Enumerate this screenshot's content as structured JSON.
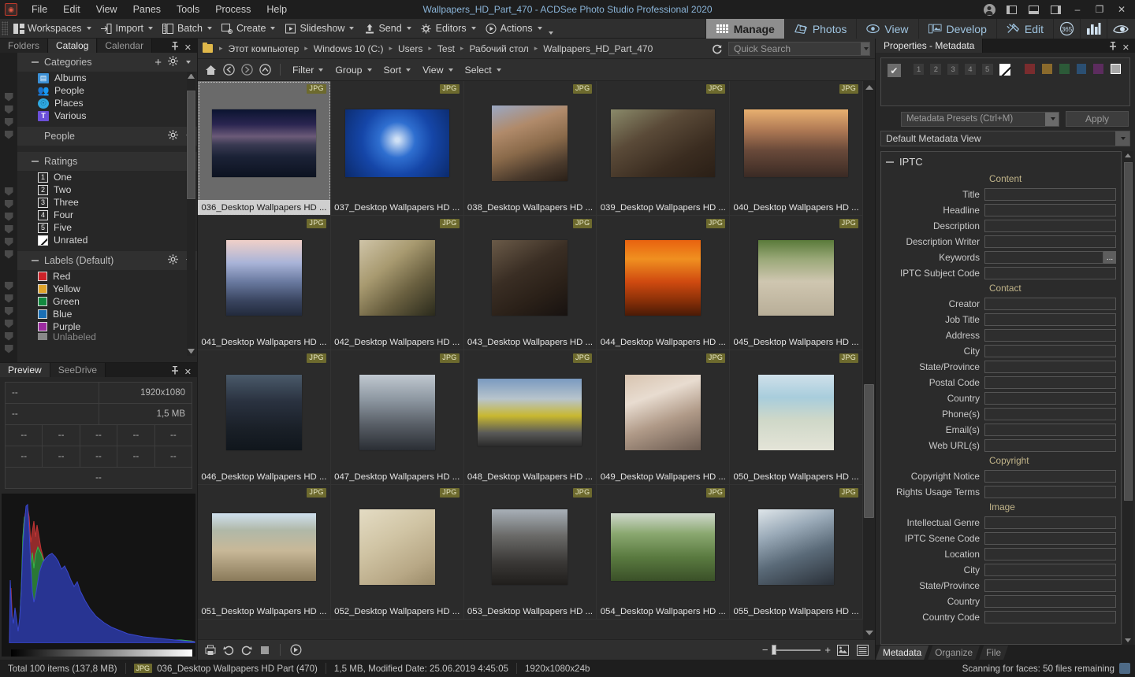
{
  "window": {
    "title": "Wallpapers_HD_Part_470 - ACDSee Photo Studio Professional 2020",
    "minimize": "–",
    "restore": "❐",
    "close": "✕"
  },
  "menubar": [
    "File",
    "Edit",
    "View",
    "Panes",
    "Tools",
    "Process",
    "Help"
  ],
  "ribbon": [
    {
      "label": "Workspaces",
      "icon": "workspaces-icon"
    },
    {
      "label": "Import",
      "icon": "import-icon"
    },
    {
      "label": "Batch",
      "icon": "batch-icon"
    },
    {
      "label": "Create",
      "icon": "create-icon"
    },
    {
      "label": "Slideshow",
      "icon": "slideshow-icon"
    },
    {
      "label": "Send",
      "icon": "send-icon"
    },
    {
      "label": "Editors",
      "icon": "editors-icon"
    },
    {
      "label": "Actions",
      "icon": "actions-icon"
    }
  ],
  "modes": [
    {
      "label": "Manage",
      "icon": "grid-icon",
      "active": true
    },
    {
      "label": "Photos",
      "icon": "photos-icon",
      "active": false
    },
    {
      "label": "View",
      "icon": "eye-icon",
      "active": false
    },
    {
      "label": "Develop",
      "icon": "develop-icon",
      "active": false
    },
    {
      "label": "Edit",
      "icon": "edit-icon",
      "active": false
    }
  ],
  "mode_extras": [
    "365",
    "chart-icon",
    "acdsee-icon"
  ],
  "left_panel": {
    "tabs": [
      {
        "label": "Folders",
        "active": false
      },
      {
        "label": "Catalog",
        "active": true
      },
      {
        "label": "Calendar",
        "active": false
      }
    ],
    "pin": "pin-icon",
    "close": "✕",
    "groups": [
      {
        "title": "Categories",
        "add": "+",
        "gear": "gear-icon",
        "items": [
          {
            "label": "Albums",
            "color": "#3b8fd4",
            "glyph": "▤"
          },
          {
            "label": "People",
            "color": "#e08a2e",
            "glyph": "👥"
          },
          {
            "label": "Places",
            "color": "#2fa8e0",
            "glyph": "🌐"
          },
          {
            "label": "Various",
            "color": "#6b4fd8",
            "glyph": "T"
          }
        ]
      },
      {
        "title": "People",
        "gear": "gear-icon",
        "items": []
      },
      {
        "title": "Ratings",
        "gear": "",
        "items": [
          {
            "label": "One",
            "badge": "1"
          },
          {
            "label": "Two",
            "badge": "2"
          },
          {
            "label": "Three",
            "badge": "3"
          },
          {
            "label": "Four",
            "badge": "4"
          },
          {
            "label": "Five",
            "badge": "5"
          },
          {
            "label": "Unrated",
            "badge": "slash"
          }
        ]
      },
      {
        "title": "Labels (Default)",
        "gear": "gear-icon",
        "items": [
          {
            "label": "Red",
            "color": "#cc2229"
          },
          {
            "label": "Yellow",
            "color": "#e0a42b"
          },
          {
            "label": "Green",
            "color": "#128a3f"
          },
          {
            "label": "Blue",
            "color": "#1a6fb5"
          },
          {
            "label": "Purple",
            "color": "#9b2ba0"
          },
          {
            "label": "Unlabeled",
            "color": "#d8d8d8"
          }
        ]
      }
    ]
  },
  "preview_panel": {
    "tabs": [
      {
        "label": "Preview",
        "active": true
      },
      {
        "label": "SeeDrive",
        "active": false
      }
    ],
    "pin": "pin-icon",
    "close": "✕",
    "rows": [
      [
        "--",
        "1920x1080"
      ],
      [
        "--",
        "1,5 MB"
      ],
      [
        "--",
        "--",
        "--",
        "--",
        "--"
      ],
      [
        "--",
        "--",
        "--",
        "--",
        "--"
      ],
      [
        "--"
      ]
    ],
    "histogram": "rgb-histogram"
  },
  "breadcrumb": {
    "folder_icon": "folder-icon",
    "items": [
      "Этот компьютер",
      "Windows 10 (C:)",
      "Users",
      "Test",
      "Рабочий стол",
      "Wallpapers_HD_Part_470"
    ],
    "separator": "▸",
    "refresh_icon": "refresh-icon"
  },
  "search": {
    "value": "",
    "placeholder": "Quick Search",
    "dropdown_icon": "chevron-down-icon"
  },
  "toolbar": {
    "icons": [
      {
        "name": "home-icon",
        "glyph": "⌂"
      },
      {
        "name": "back-icon",
        "glyph": "←"
      },
      {
        "name": "forward-icon",
        "glyph": "→"
      },
      {
        "name": "up-icon",
        "glyph": "↑"
      }
    ],
    "menus": [
      "Filter",
      "Group",
      "Sort",
      "View",
      "Select"
    ]
  },
  "grid": {
    "badge": "JPG",
    "items": [
      {
        "caption": "036_Desktop Wallpapers  HD ...",
        "selected": true,
        "style": "milkyway"
      },
      {
        "caption": "037_Desktop Wallpapers  HD ...",
        "selected": false,
        "style": "bluebug"
      },
      {
        "caption": "038_Desktop Wallpapers  HD ...",
        "selected": false,
        "style": "warriorgirl"
      },
      {
        "caption": "039_Desktop Wallpapers  HD ...",
        "selected": false,
        "style": "dogball"
      },
      {
        "caption": "040_Desktop Wallpapers  HD ...",
        "selected": false,
        "style": "citystreet"
      },
      {
        "caption": "041_Desktop Wallpapers  HD ...",
        "selected": false,
        "style": "pierpath"
      },
      {
        "caption": "042_Desktop Wallpapers  HD ...",
        "selected": false,
        "style": "monster"
      },
      {
        "caption": "043_Desktop Wallpapers  HD ...",
        "selected": false,
        "style": "couple"
      },
      {
        "caption": "044_Desktop Wallpapers  HD ...",
        "selected": false,
        "style": "sunsetdock"
      },
      {
        "caption": "045_Desktop Wallpapers  HD ...",
        "selected": false,
        "style": "grasssand"
      },
      {
        "caption": "046_Desktop Wallpapers  HD ...",
        "selected": false,
        "style": "darkcloak"
      },
      {
        "caption": "047_Desktop Wallpapers  HD ...",
        "selected": false,
        "style": "windmill"
      },
      {
        "caption": "048_Desktop Wallpapers  HD ...",
        "selected": false,
        "style": "cars"
      },
      {
        "caption": "049_Desktop Wallpapers  HD ...",
        "selected": false,
        "style": "bride"
      },
      {
        "caption": "050_Desktop Wallpapers  HD ...",
        "selected": false,
        "style": "watercolor"
      },
      {
        "caption": "051_Desktop Wallpapers  HD ...",
        "selected": false,
        "style": "beachgirl"
      },
      {
        "caption": "052_Desktop Wallpapers  HD ...",
        "selected": false,
        "style": "sheetmusic"
      },
      {
        "caption": "053_Desktop Wallpapers  HD ...",
        "selected": false,
        "style": "tattoo"
      },
      {
        "caption": "054_Desktop Wallpapers  HD ...",
        "selected": false,
        "style": "greengrass"
      },
      {
        "caption": "055_Desktop Wallpapers  HD ...",
        "selected": false,
        "style": "anime"
      }
    ]
  },
  "bottom_toolbar": {
    "icons": [
      "print-icon",
      "rotate-left-icon",
      "rotate-right-icon",
      "stop-icon",
      "play-icon"
    ],
    "zoom_minus": "−",
    "zoom_plus": "+",
    "view_icons": [
      "thumbnail-view-icon",
      "detail-view-icon"
    ]
  },
  "right_panel": {
    "tab": "Properties - Metadata",
    "pin": "pin-icon",
    "close": "✕",
    "rating_checkbox": "✔",
    "ratings": [
      "1",
      "2",
      "3",
      "4",
      "5"
    ],
    "unrated": "slash",
    "label_colors": [
      "#7a2c2e",
      "#8a6a2c",
      "#2c5a38",
      "#2b4f72",
      "#5c2c5e",
      "#a8a8a8"
    ],
    "preset_combo": {
      "value": "Metadata Presets (Ctrl+M)",
      "dropdown_icon": "chevron-down-icon"
    },
    "apply_button": "Apply",
    "view_combo": {
      "value": "Default Metadata View",
      "dropdown_icon": "chevron-down-icon"
    },
    "section": {
      "title": "IPTC",
      "collapse_icon": "minus-icon",
      "blocks": [
        {
          "heading": "Content",
          "fields": [
            {
              "label": "Title",
              "value": ""
            },
            {
              "label": "Headline",
              "value": ""
            },
            {
              "label": "Description",
              "value": ""
            },
            {
              "label": "Description Writer",
              "value": ""
            },
            {
              "label": "Keywords",
              "value": "",
              "button": "..."
            },
            {
              "label": "IPTC Subject Code",
              "value": ""
            }
          ]
        },
        {
          "heading": "Contact",
          "fields": [
            {
              "label": "Creator",
              "value": ""
            },
            {
              "label": "Job Title",
              "value": ""
            },
            {
              "label": "Address",
              "value": ""
            },
            {
              "label": "City",
              "value": ""
            },
            {
              "label": "State/Province",
              "value": ""
            },
            {
              "label": "Postal Code",
              "value": ""
            },
            {
              "label": "Country",
              "value": ""
            },
            {
              "label": "Phone(s)",
              "value": ""
            },
            {
              "label": "Email(s)",
              "value": ""
            },
            {
              "label": "Web URL(s)",
              "value": ""
            }
          ]
        },
        {
          "heading": "Copyright",
          "fields": [
            {
              "label": "Copyright Notice",
              "value": ""
            },
            {
              "label": "Rights Usage Terms",
              "value": ""
            }
          ]
        },
        {
          "heading": "Image",
          "fields": [
            {
              "label": "Intellectual Genre",
              "value": ""
            },
            {
              "label": "IPTC Scene Code",
              "value": ""
            },
            {
              "label": "Location",
              "value": ""
            },
            {
              "label": "City",
              "value": ""
            },
            {
              "label": "State/Province",
              "value": ""
            },
            {
              "label": "Country",
              "value": ""
            },
            {
              "label": "Country Code",
              "value": ""
            }
          ]
        }
      ]
    },
    "bottom_tabs": [
      {
        "label": "Metadata",
        "active": true
      },
      {
        "label": "Organize",
        "active": false
      },
      {
        "label": "File",
        "active": false
      }
    ]
  },
  "statusbar": {
    "total": "Total 100 items  (137,8 MB)",
    "badge": "JPG",
    "filename": "036_Desktop Wallpapers  HD Part (470)",
    "fileinfo": "1,5 MB, Modified Date: 25.06.2019 4:45:05",
    "dimensions": "1920x1080x24b",
    "task": "Scanning for faces: 50 files remaining",
    "task_icon": "face-scan-icon"
  }
}
